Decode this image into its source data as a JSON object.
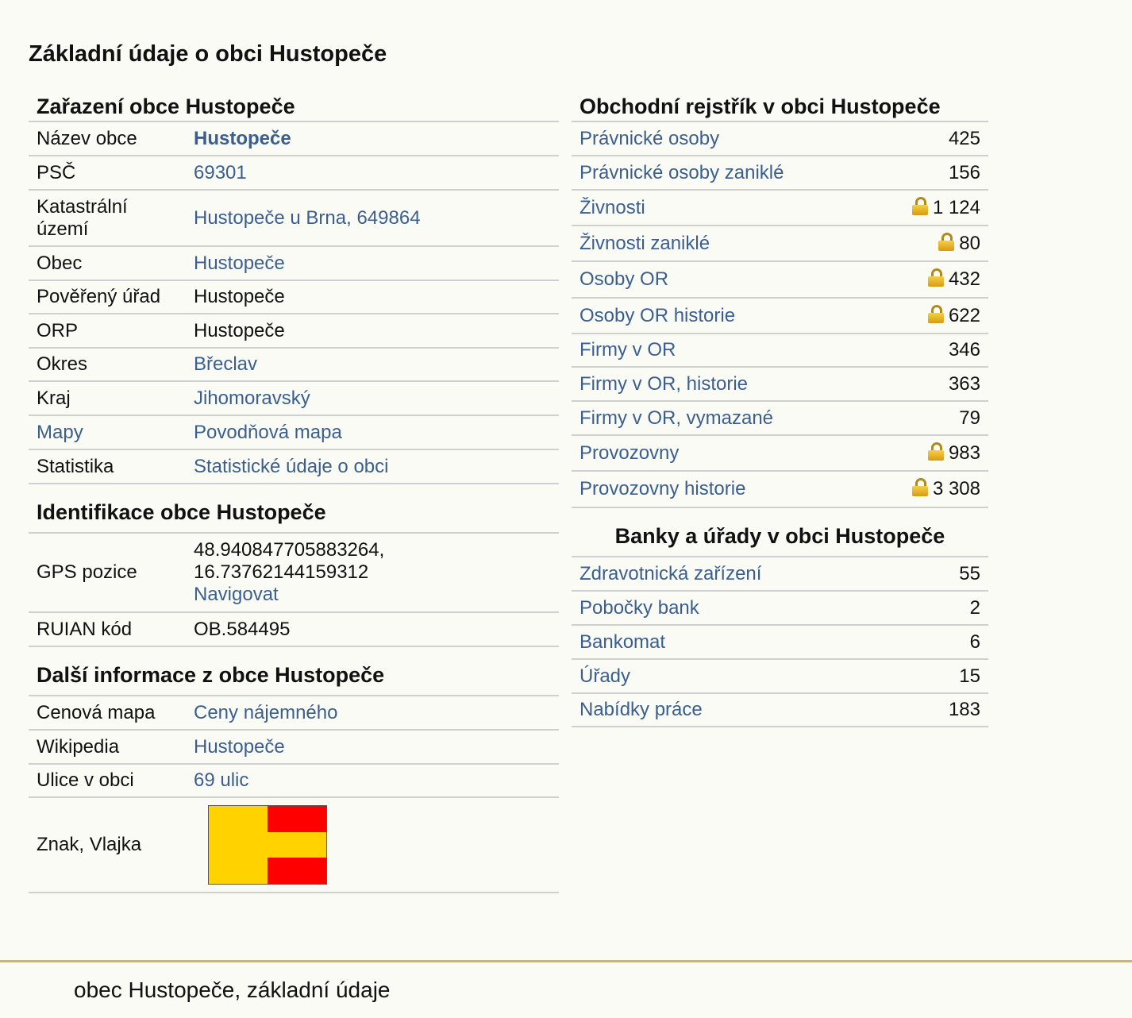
{
  "page": {
    "title": "Základní údaje o obci Hustopeče",
    "footer": "obec Hustopeče, základní údaje"
  },
  "zarazeni": {
    "title": "Zařazení obce Hustopeče",
    "rows": [
      {
        "key": "Název obce",
        "value": "Hustopeče"
      },
      {
        "key": "PSČ",
        "value": "69301"
      },
      {
        "key": "Katastrální území",
        "value": "Hustopeče u Brna, 649864"
      },
      {
        "key": "Obec",
        "value": "Hustopeče"
      },
      {
        "key": "Pověřený úřad",
        "value": "Hustopeče"
      },
      {
        "key": "ORP",
        "value": "Hustopeče"
      },
      {
        "key": "Okres",
        "value": "Břeclav"
      },
      {
        "key": "Kraj",
        "value": "Jihomoravský"
      },
      {
        "key": "Mapy",
        "value": "Povodňová mapa"
      },
      {
        "key": "Statistika",
        "value": "Statistické údaje o obci"
      }
    ]
  },
  "identifikace": {
    "title": "Identifikace obce Hustopeče",
    "gps_label": "GPS pozice",
    "gps_lat": "48.940847705883264,",
    "gps_lon": "16.73762144159312",
    "navigate": "Navigovat",
    "ruian_label": "RUIAN kód",
    "ruian_value": "OB.584495"
  },
  "dalsi": {
    "title": "Další informace z obce Hustopeče",
    "rows": [
      {
        "key": "Cenová mapa",
        "value": "Ceny nájemného"
      },
      {
        "key": "Wikipedia",
        "value": "Hustopeče"
      },
      {
        "key": "Ulice v obci",
        "value": "69 ulic"
      }
    ],
    "flag_label": "Znak, Vlajka",
    "flag_colors": {
      "yellow": "#ffd200",
      "red": "#ff0000"
    }
  },
  "rejstrik": {
    "title": "Obchodní rejstřík v obci Hustopeče",
    "rows": [
      {
        "label": "Právnické osoby",
        "value": "425",
        "locked": false
      },
      {
        "label": "Právnické osoby zaniklé",
        "value": "156",
        "locked": false
      },
      {
        "label": "Živnosti",
        "value": "1 124",
        "locked": true
      },
      {
        "label": "Živnosti zaniklé",
        "value": "80",
        "locked": true
      },
      {
        "label": "Osoby OR",
        "value": "432",
        "locked": true
      },
      {
        "label": "Osoby OR historie",
        "value": "622",
        "locked": true
      },
      {
        "label": "Firmy v OR",
        "value": "346",
        "locked": false
      },
      {
        "label": "Firmy v OR, historie",
        "value": "363",
        "locked": false
      },
      {
        "label": "Firmy v OR, vymazané",
        "value": "79",
        "locked": false
      },
      {
        "label": "Provozovny",
        "value": "983",
        "locked": true
      },
      {
        "label": "Provozovny historie",
        "value": "3 308",
        "locked": true
      }
    ],
    "lock_icon": "lock-icon"
  },
  "banky": {
    "title": "Banky a úřady v obci Hustopeče",
    "rows": [
      {
        "label": "Zdravotnická zařízení",
        "value": "55"
      },
      {
        "label": "Pobočky bank",
        "value": "2"
      },
      {
        "label": "Bankomat",
        "value": "6"
      },
      {
        "label": "Úřady",
        "value": "15"
      },
      {
        "label": "Nabídky práce",
        "value": "183"
      }
    ]
  },
  "colors": {
    "link": "#3a5f8f",
    "row_border": "#cfcfcf",
    "footer_line": "#d9b64a",
    "background": "#fbfbf6"
  }
}
